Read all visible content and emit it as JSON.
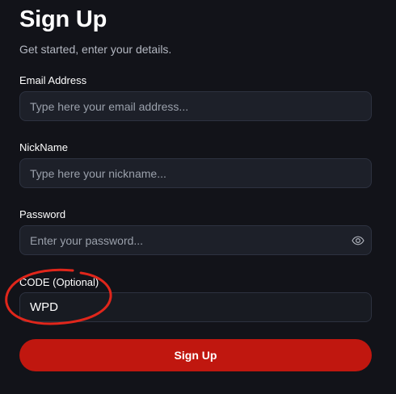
{
  "header": {
    "title": "Sign Up",
    "subtitle": "Get started, enter your details."
  },
  "form": {
    "email": {
      "label": "Email Address",
      "placeholder": "Type here your email address...",
      "value": ""
    },
    "nickname": {
      "label": "NickName",
      "placeholder": "Type here your nickname...",
      "value": ""
    },
    "password": {
      "label": "Password",
      "placeholder": "Enter your password...",
      "value": "",
      "toggle_icon": "eye-icon"
    },
    "code": {
      "label": "CODE (Optional)",
      "placeholder": "",
      "value": "WPD"
    },
    "submit_label": "Sign Up"
  },
  "theme": {
    "background": "#121319",
    "field_background": "#1d2029",
    "field_border": "#2d3240",
    "accent": "#c0170f",
    "annotation": "#e0261b"
  }
}
